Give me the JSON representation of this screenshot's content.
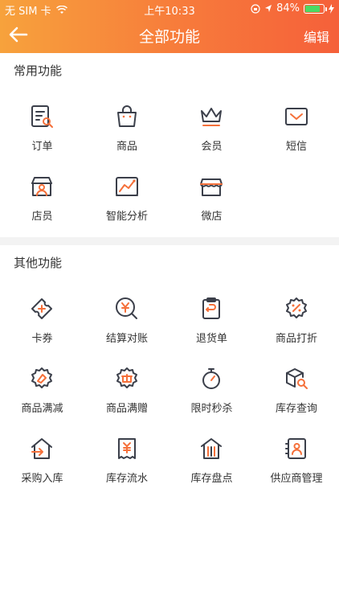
{
  "status_bar": {
    "carrier": "无 SIM 卡",
    "time": "上午10:33",
    "battery": "84%",
    "battery_level": 0.84
  },
  "navbar": {
    "title": "全部功能",
    "edit": "编辑"
  },
  "sections": [
    {
      "title": "常用功能",
      "items": [
        {
          "label": "订单",
          "icon": "order-icon"
        },
        {
          "label": "商品",
          "icon": "shopping-bag-icon"
        },
        {
          "label": "会员",
          "icon": "crown-icon"
        },
        {
          "label": "短信",
          "icon": "message-icon"
        },
        {
          "label": "店员",
          "icon": "clerk-icon"
        },
        {
          "label": "智能分析",
          "icon": "analysis-icon"
        },
        {
          "label": "微店",
          "icon": "store-icon"
        }
      ]
    },
    {
      "title": "其他功能",
      "items": [
        {
          "label": "卡券",
          "icon": "coupon-icon"
        },
        {
          "label": "结算对账",
          "icon": "settlement-icon"
        },
        {
          "label": "退货单",
          "icon": "return-order-icon"
        },
        {
          "label": "商品打折",
          "icon": "discount-icon"
        },
        {
          "label": "商品满减",
          "icon": "full-reduction-icon"
        },
        {
          "label": "商品满赠",
          "icon": "full-gift-icon"
        },
        {
          "label": "限时秒杀",
          "icon": "stopwatch-icon"
        },
        {
          "label": "库存查询",
          "icon": "inventory-search-icon"
        },
        {
          "label": "采购入库",
          "icon": "purchase-in-icon"
        },
        {
          "label": "库存流水",
          "icon": "inventory-flow-icon"
        },
        {
          "label": "库存盘点",
          "icon": "inventory-check-icon"
        },
        {
          "label": "供应商管理",
          "icon": "supplier-icon"
        }
      ]
    }
  ],
  "colors": {
    "dark": "#3b3f4a",
    "accent": "#f5703a"
  }
}
